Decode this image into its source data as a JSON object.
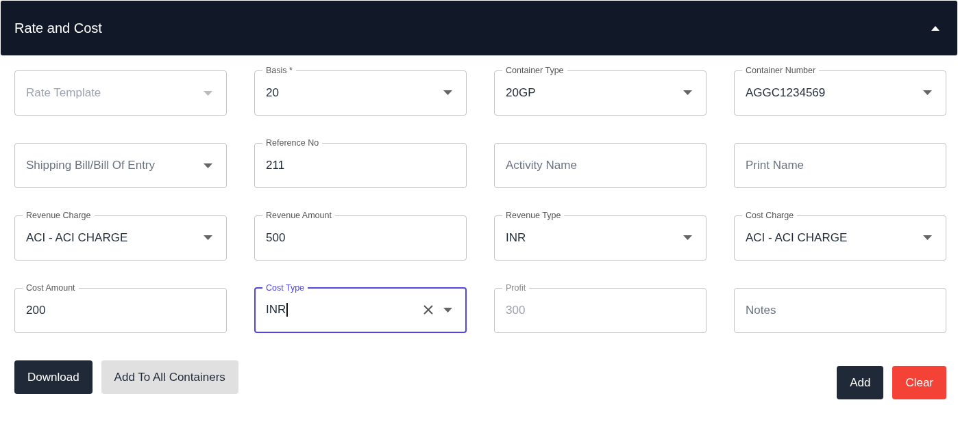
{
  "panel": {
    "title": "Rate and Cost",
    "expanded": true
  },
  "fields": [
    {
      "kind": "select",
      "placeholder": "Rate Template",
      "disabled": true
    },
    {
      "kind": "select",
      "label": "Basis *",
      "value": "20"
    },
    {
      "kind": "select",
      "label": "Container Type",
      "value": "20GP"
    },
    {
      "kind": "select",
      "label": "Container Number",
      "value": "AGGC1234569"
    },
    {
      "kind": "select",
      "placeholder": "Shipping Bill/Bill Of Entry"
    },
    {
      "kind": "text",
      "label": "Reference No",
      "value": "211"
    },
    {
      "kind": "text",
      "placeholder": "Activity Name"
    },
    {
      "kind": "text",
      "placeholder": "Print Name"
    },
    {
      "kind": "select",
      "label": "Revenue Charge",
      "value": "ACI - ACI CHARGE"
    },
    {
      "kind": "text",
      "label": "Revenue Amount",
      "value": "500"
    },
    {
      "kind": "select",
      "label": "Revenue Type",
      "value": "INR"
    },
    {
      "kind": "select",
      "label": "Cost Charge",
      "value": "ACI - ACI CHARGE"
    },
    {
      "kind": "text",
      "label": "Cost Amount",
      "value": "200"
    },
    {
      "kind": "select",
      "label": "Cost Type",
      "value": "INR",
      "focused": true,
      "clearable": true
    },
    {
      "kind": "text",
      "label": "Profit",
      "value": "300",
      "disabled": true
    },
    {
      "kind": "text",
      "placeholder": "Notes"
    }
  ],
  "left_buttons": [
    {
      "label": "Download",
      "kind": "primary"
    },
    {
      "label": "Add To All Containers",
      "kind": "secondary"
    }
  ],
  "right_buttons": [
    {
      "label": "Add",
      "kind": "primary"
    },
    {
      "label": "Clear",
      "kind": "danger"
    }
  ]
}
